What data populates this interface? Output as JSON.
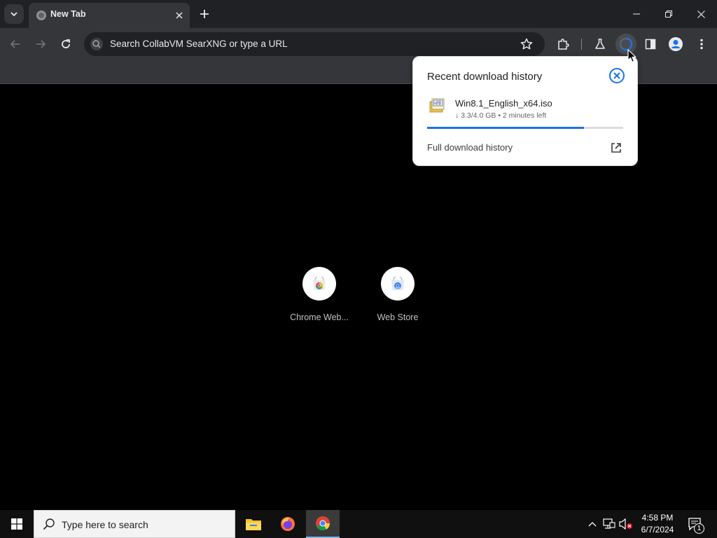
{
  "tab": {
    "title": "New Tab"
  },
  "omnibox": {
    "placeholder": "Search CollabVM SearXNG or type a URL"
  },
  "shortcuts": [
    {
      "label": "Chrome Web..."
    },
    {
      "label": "Web Store"
    }
  ],
  "download_popup": {
    "title": "Recent download history",
    "file_name": "Win8.1_English_x64.iso",
    "status": "↓ 3.3/4.0 GB • 2 minutes left",
    "progress_fraction": 0.8,
    "history_link": "Full download history"
  },
  "taskbar": {
    "search_placeholder": "Type here to search",
    "time": "4:58 PM",
    "date": "6/7/2024",
    "notification_count": "1"
  },
  "colors": {
    "accent": "#1a73e8",
    "titlebar": "#202124",
    "toolbar": "#35363a",
    "taskbar": "#101010"
  }
}
